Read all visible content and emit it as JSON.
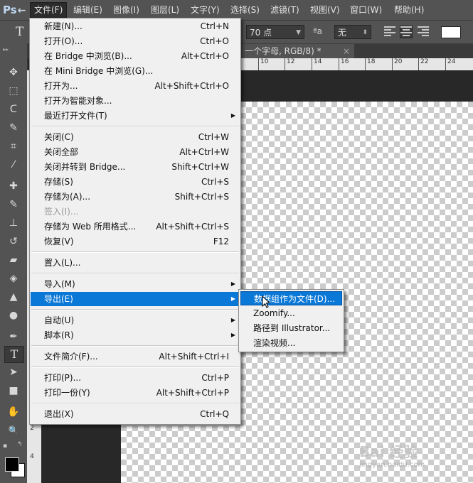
{
  "app": {
    "logo": "Ps"
  },
  "menubar": [
    {
      "label": "文件(F)",
      "active": true
    },
    {
      "label": "编辑(E)"
    },
    {
      "label": "图像(I)"
    },
    {
      "label": "图层(L)"
    },
    {
      "label": "文字(Y)"
    },
    {
      "label": "选择(S)"
    },
    {
      "label": "滤镜(T)"
    },
    {
      "label": "视图(V)"
    },
    {
      "label": "窗口(W)"
    },
    {
      "label": "帮助(H)"
    }
  ],
  "options": {
    "tool_icon": "T",
    "font_size": "70 点",
    "aa_icon": "ªa",
    "antialias": "无",
    "color": "#ffffff"
  },
  "document_tab": {
    "title": "一个字母, RGB/8) *",
    "close": "×"
  },
  "ruler": {
    "h_ticks": [
      "10",
      "12",
      "14",
      "16",
      "18",
      "20",
      "22",
      "24"
    ],
    "v_ticks": [
      "2",
      "4"
    ]
  },
  "file_menu": [
    {
      "label": "新建(N)...",
      "shortcut": "Ctrl+N"
    },
    {
      "label": "打开(O)...",
      "shortcut": "Ctrl+O"
    },
    {
      "label": "在 Bridge 中浏览(B)...",
      "shortcut": "Alt+Ctrl+O"
    },
    {
      "label": "在 Mini Bridge 中浏览(G)...",
      "shortcut": ""
    },
    {
      "label": "打开为...",
      "shortcut": "Alt+Shift+Ctrl+O"
    },
    {
      "label": "打开为智能对象...",
      "shortcut": ""
    },
    {
      "label": "最近打开文件(T)",
      "shortcut": "",
      "submenu": true
    },
    {
      "separator": true
    },
    {
      "label": "关闭(C)",
      "shortcut": "Ctrl+W"
    },
    {
      "label": "关闭全部",
      "shortcut": "Alt+Ctrl+W"
    },
    {
      "label": "关闭并转到 Bridge...",
      "shortcut": "Shift+Ctrl+W"
    },
    {
      "label": "存储(S)",
      "shortcut": "Ctrl+S"
    },
    {
      "label": "存储为(A)...",
      "shortcut": "Shift+Ctrl+S"
    },
    {
      "label": "签入(I)...",
      "shortcut": "",
      "disabled": true
    },
    {
      "label": "存储为 Web 所用格式...",
      "shortcut": "Alt+Shift+Ctrl+S"
    },
    {
      "label": "恢复(V)",
      "shortcut": "F12"
    },
    {
      "separator": true
    },
    {
      "label": "置入(L)...",
      "shortcut": ""
    },
    {
      "separator": true
    },
    {
      "label": "导入(M)",
      "shortcut": "",
      "submenu": true
    },
    {
      "label": "导出(E)",
      "shortcut": "",
      "submenu": true,
      "highlighted": true
    },
    {
      "separator": true
    },
    {
      "label": "自动(U)",
      "shortcut": "",
      "submenu": true
    },
    {
      "label": "脚本(R)",
      "shortcut": "",
      "submenu": true
    },
    {
      "separator": true
    },
    {
      "label": "文件简介(F)...",
      "shortcut": "Alt+Shift+Ctrl+I"
    },
    {
      "separator": true
    },
    {
      "label": "打印(P)...",
      "shortcut": "Ctrl+P"
    },
    {
      "label": "打印一份(Y)",
      "shortcut": "Alt+Shift+Ctrl+P"
    },
    {
      "separator": true
    },
    {
      "label": "退出(X)",
      "shortcut": "Ctrl+Q"
    }
  ],
  "export_submenu": [
    {
      "label": "数据组作为文件(D)...",
      "highlighted": true
    },
    {
      "label": "Zoomify..."
    },
    {
      "label": "路径到 Illustrator..."
    },
    {
      "label": "渲染视频..."
    }
  ],
  "tools": [
    {
      "name": "move-tool-icon",
      "glyph": "✥"
    },
    {
      "name": "marquee-tool-icon",
      "glyph": "⬚"
    },
    {
      "name": "lasso-tool-icon",
      "glyph": "ᑕ"
    },
    {
      "name": "quick-select-tool-icon",
      "glyph": "✎"
    },
    {
      "name": "crop-tool-icon",
      "glyph": "⌗"
    },
    {
      "name": "eyedropper-tool-icon",
      "glyph": "⁄"
    },
    {
      "name": "healing-brush-tool-icon",
      "glyph": "✚"
    },
    {
      "name": "brush-tool-icon",
      "glyph": "✎"
    },
    {
      "name": "clone-stamp-tool-icon",
      "glyph": "⊥"
    },
    {
      "name": "history-brush-tool-icon",
      "glyph": "↺"
    },
    {
      "name": "eraser-tool-icon",
      "glyph": "▰"
    },
    {
      "name": "paint-bucket-tool-icon",
      "glyph": "◈"
    },
    {
      "name": "blur-tool-icon",
      "glyph": "▲"
    },
    {
      "name": "dodge-tool-icon",
      "glyph": "●"
    },
    {
      "name": "pen-tool-icon",
      "glyph": "✒"
    },
    {
      "name": "type-tool-icon",
      "glyph": "T",
      "selected": true
    },
    {
      "name": "path-select-tool-icon",
      "glyph": "➤"
    },
    {
      "name": "shape-tool-icon",
      "glyph": "■"
    },
    {
      "name": "hand-tool-icon",
      "glyph": "✋"
    },
    {
      "name": "zoom-tool-icon",
      "glyph": "🔍"
    }
  ],
  "watermark": {
    "text": "Bai 经验",
    "sub": "jingyan.baidu.com"
  }
}
